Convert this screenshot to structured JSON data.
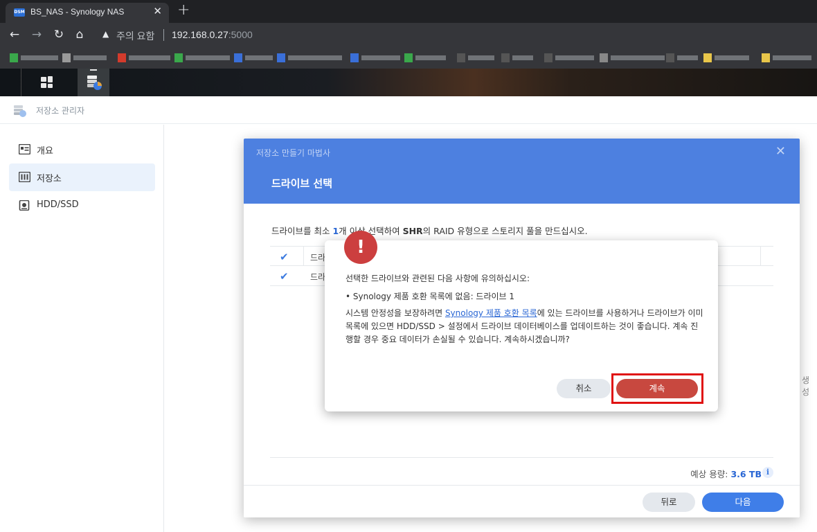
{
  "browser": {
    "tab_title": "BS_NAS - Synology NAS",
    "tab_favicon_text": "DSM",
    "security_warning": "주의 요함",
    "url_host": "192.168.0.27",
    "url_port": ":5000"
  },
  "app": {
    "title": "저장소 관리자"
  },
  "sidebar": {
    "items": [
      {
        "label": "개요",
        "icon": "overview-icon"
      },
      {
        "label": "저장소",
        "icon": "storage-icon"
      },
      {
        "label": "HDD/SSD",
        "icon": "hdd-icon"
      }
    ]
  },
  "content": {
    "edge_text": "생성"
  },
  "wizard": {
    "app_title": "저장소 만들기 마법사",
    "step_title": "드라이브 선택",
    "desc_prefix": "드라이브를 최소 ",
    "desc_count": "1",
    "desc_mid": "개 이상 선택하여 ",
    "desc_raid": "SHR",
    "desc_suffix": "의 RAID 유형으로 스토리지 풀을 만드십시오.",
    "table_header_partial": "드라",
    "table_row_partial": "드라",
    "capacity_label": "예상 용량:",
    "capacity_value": "3.6 TB",
    "back_button": "뒤로",
    "next_button": "다음"
  },
  "alert": {
    "title": "선택한 드라이브와 관련된 다음 사항에 유의하십시오:",
    "bullet": "• Synology 제품 호환 목록에 없음: 드라이브 1",
    "body_prefix": "시스템 안정성을 보장하려면 ",
    "body_link": "Synology 제품 호환 목록",
    "body_suffix": "에 있는 드라이브를 사용하거나 드라이브가 이미 목록에 있으면 HDD/SSD > 설정에서 드라이브 데이터베이스를 업데이트하는 것이 좋습니다. 계속 진행할 경우 중요 데이터가 손실될 수 있습니다. 계속하시겠습니까?",
    "cancel_button": "취소",
    "continue_button": "계속"
  },
  "colors": {
    "wizard_header": "#4d80e0",
    "alert_icon": "#cc3f3f",
    "continue_button": "#c8483f",
    "next_button": "#3f7ee8",
    "highlight": "#e01212"
  }
}
